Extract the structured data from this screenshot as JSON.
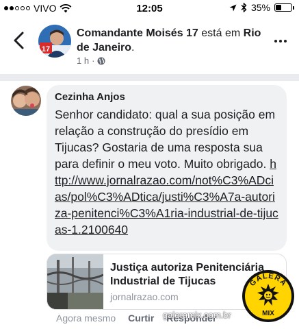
{
  "status_bar": {
    "carrier": "VIVO",
    "time": "12:05",
    "battery": "35%",
    "battery_level": 0.35,
    "icons": [
      "signal-dots-icon",
      "wifi-icon",
      "location-arrow-icon",
      "bluetooth-icon",
      "battery-icon"
    ]
  },
  "post": {
    "author": "Comandante Moisés 17",
    "action_text": " está em ",
    "location": "Rio de Janeiro",
    "location_suffix": ".",
    "time": "1 h",
    "separator": "·",
    "icons": [
      "back-chevron-icon",
      "globe-icon",
      "more-options-icon"
    ]
  },
  "comment": {
    "name": "Cezinha Anjos",
    "text": "Senhor candidato: qual a sua posição em relação a construção do presídio em Tijucas? Gostaria de uma resposta sua para definir o meu voto. Muito obrigado.",
    "link": "http://www.jornalrazao.com/not%C3%ADcias/pol%C3%ADtica/justi%C3%A7a-autoriza-penitenci%C3%A1ria-industrial-de-tijucas-1.2100640"
  },
  "link_preview": {
    "title": "Justiça autoriza Penitenciária Industrial de Tijucas",
    "domain": "jornalrazao.com"
  },
  "actions": {
    "time": "Agora mesmo",
    "like": "Curtir",
    "reply": "Responder"
  },
  "watermark": {
    "site": "galeramix.com.br",
    "logo_text_top": "GALERA",
    "logo_text_bottom": "MIX"
  },
  "colors": {
    "bubble": "#f0f1f3",
    "secondary_text": "#606770",
    "badge_yellow": "#ffd400"
  }
}
